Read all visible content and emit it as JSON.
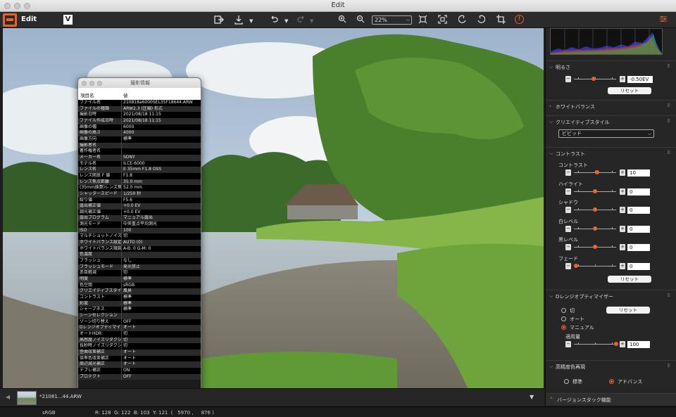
{
  "window": {
    "title": "Edit"
  },
  "toolbar": {
    "mode_label": "Edit",
    "v_logo": "V",
    "zoom_value": "22%",
    "accent": "#e8622a"
  },
  "exif": {
    "title": "撮影情報",
    "col_name": "項目名",
    "col_value": "値",
    "rows": [
      {
        "k": "ファイル名",
        "v": "210818a6000SEL35F18644.ARW"
      },
      {
        "k": "ファイルの種類",
        "v": "ARW2.3 (圧縮) 形式"
      },
      {
        "k": "撮影日時",
        "v": "2021/08/18 11:15"
      },
      {
        "k": "ファイル作成日時",
        "v": "2021/08/18 11:15"
      },
      {
        "k": "画像の幅",
        "v": "6000"
      },
      {
        "k": "画像の高さ",
        "v": "4000"
      },
      {
        "k": "画像方向",
        "v": "標準"
      },
      {
        "k": "撮影者名",
        "v": ""
      },
      {
        "k": "著作権者名",
        "v": ""
      },
      {
        "k": "メーカー名",
        "v": "SONY"
      },
      {
        "k": "モデル名",
        "v": "ILCE-6000"
      },
      {
        "k": "レンズ名",
        "v": "E 35mm F1.8 OSS"
      },
      {
        "k": "レンズ開放 F 値",
        "v": "F1.8"
      },
      {
        "k": "レンズ焦点距離",
        "v": "35.0 mm"
      },
      {
        "k": "(35mm換算)レンズ焦",
        "v": "52.0 mm"
      },
      {
        "k": "シャッタースピード",
        "v": "1/250 秒"
      },
      {
        "k": "絞り値",
        "v": "F5.6"
      },
      {
        "k": "露出補正値",
        "v": "+0.0 EV"
      },
      {
        "k": "調光補正値",
        "v": "+0.0 EV"
      },
      {
        "k": "露出プログラム",
        "v": "マニュアル露出"
      },
      {
        "k": "測光モード",
        "v": "中央重点平均測光"
      },
      {
        "k": "ISO",
        "v": "100"
      },
      {
        "k": "マルチショットノイズ",
        "v": "切"
      },
      {
        "k": "ホワイトバランス設定",
        "v": "AUTO (0)"
      },
      {
        "k": "ホワイトバランス微調",
        "v": "A-B: 0 G-M: 0"
      },
      {
        "k": "色温度",
        "v": ""
      },
      {
        "k": "フラッシュ",
        "v": "なし"
      },
      {
        "k": "フラッシュモード",
        "v": "発光禁止"
      },
      {
        "k": "赤目軽減",
        "v": "切"
      },
      {
        "k": "明度",
        "v": "標準"
      },
      {
        "k": "色空間",
        "v": "sRGB"
      },
      {
        "k": "クリエイティブスタイ",
        "v": "風景"
      },
      {
        "k": "コントラスト",
        "v": "標準"
      },
      {
        "k": "彩度",
        "v": "標準"
      },
      {
        "k": "シャープネス",
        "v": "標準"
      },
      {
        "k": "シーンセレクション",
        "v": ""
      },
      {
        "k": "ゾーン切り替え",
        "v": "OFF"
      },
      {
        "k": "Dレンジオプティマイ",
        "v": "オート"
      },
      {
        "k": "オートHDR",
        "v": "切"
      },
      {
        "k": "高感度ノイズリダクシ",
        "v": "切"
      },
      {
        "k": "長秒時ノイズリダクシ",
        "v": "切"
      },
      {
        "k": "歪曲収差補正",
        "v": "オート"
      },
      {
        "k": "倍率色収差補正",
        "v": "オート"
      },
      {
        "k": "周辺減光補正",
        "v": "オート"
      },
      {
        "k": "テブレ補正",
        "v": "ON"
      },
      {
        "k": "プロテクト",
        "v": "OFF"
      }
    ]
  },
  "filmstrip": {
    "thumb_name": "*21081...44.ARW"
  },
  "status": {
    "color_space": "sRGB",
    "readout": "R: 128  G: 122  B: 103  Y: 121  (   5970 ,     876 )"
  },
  "panel": {
    "brightness": {
      "title": "明るさ",
      "value": "-0.50EV",
      "level": 0.46,
      "reset": "リセット"
    },
    "white_balance": {
      "title": "ホワイトバランス"
    },
    "creative_style": {
      "title": "クリエイティブスタイル",
      "selected": "ビビッド"
    },
    "contrast": {
      "title": "コントラスト",
      "reset": "リセット",
      "sliders": [
        {
          "label": "コントラスト",
          "value": "10",
          "level": 0.55
        },
        {
          "label": "ハイライト",
          "value": "0",
          "level": 0.5
        },
        {
          "label": "シャドウ",
          "value": "0",
          "level": 0.5
        },
        {
          "label": "白レベル",
          "value": "0",
          "level": 0.5
        },
        {
          "label": "黒レベル",
          "value": "0",
          "level": 0.5
        },
        {
          "label": "フェード",
          "value": "0",
          "level": 0.05
        }
      ]
    },
    "dro": {
      "title": "Dレンジオプティマイザー",
      "options": [
        "切",
        "オート",
        "マニュアル"
      ],
      "selected": 2,
      "reset": "リセット",
      "amount_label": "適用量",
      "amount_value": "100",
      "amount_level": 1.0
    },
    "hi_precision": {
      "title": "高精度色再現",
      "options": [
        "標準",
        "アドバンス"
      ],
      "selected": 1
    },
    "version_stack": {
      "title": "バージョンスタック機能"
    }
  }
}
